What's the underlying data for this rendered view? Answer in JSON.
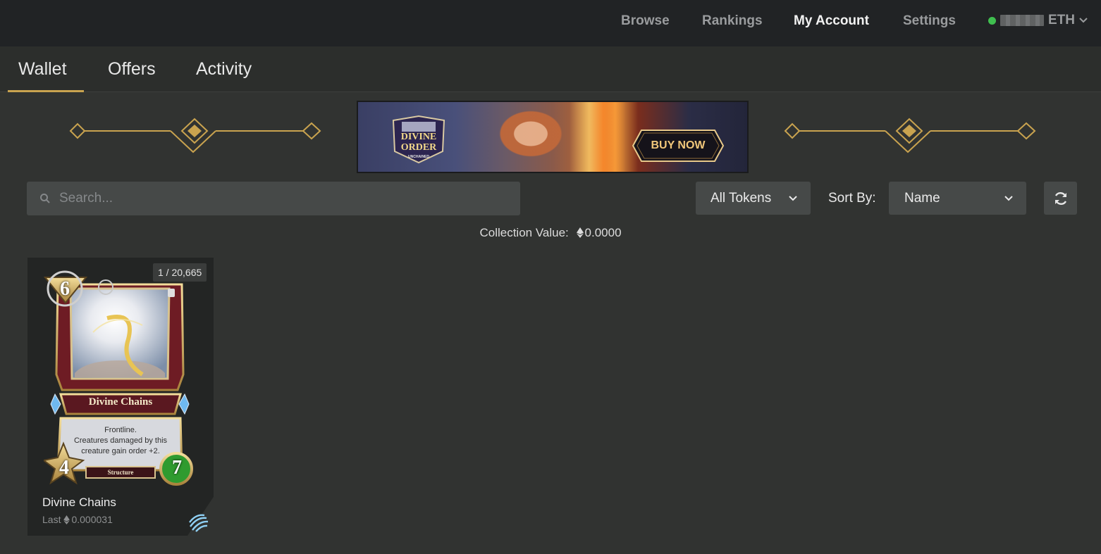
{
  "nav": {
    "browse": "Browse",
    "rankings": "Rankings",
    "my_account": "My Account",
    "settings": "Settings",
    "currency": "ETH"
  },
  "tabs": {
    "wallet": "Wallet",
    "offers": "Offers",
    "activity": "Activity"
  },
  "banner": {
    "button": "BUY NOW",
    "logo_line1": "DIVINE",
    "logo_line2": "ORDER",
    "logo_line3": "UNCHAINED"
  },
  "filters": {
    "search_placeholder": "Search...",
    "tokens_select": "All Tokens",
    "sort_label": "Sort By:",
    "sort_select": "Name"
  },
  "collection": {
    "label": "Collection Value:",
    "value": "0.0000"
  },
  "cards": [
    {
      "edition": "1 / 20,665",
      "name": "Divine Chains",
      "card_title": "Divine Chains",
      "description_line1": "Frontline.",
      "description_line2": "Creatures damaged by this",
      "description_line3": "creature gain order +2.",
      "type": "Structure",
      "mana": "6",
      "attack": "4",
      "health": "7",
      "last_label": "Last",
      "last_price": "0.000031"
    }
  ],
  "colors": {
    "accent_gold": "#c9a34f",
    "status_green": "#3fbf4f",
    "page_bg": "#313331",
    "topbar_bg": "#212325"
  },
  "icons": {
    "search": "search-icon",
    "chevron": "chevron-down-icon",
    "refresh": "refresh-icon",
    "eth": "ethereum-icon",
    "status": "online-dot-icon"
  }
}
